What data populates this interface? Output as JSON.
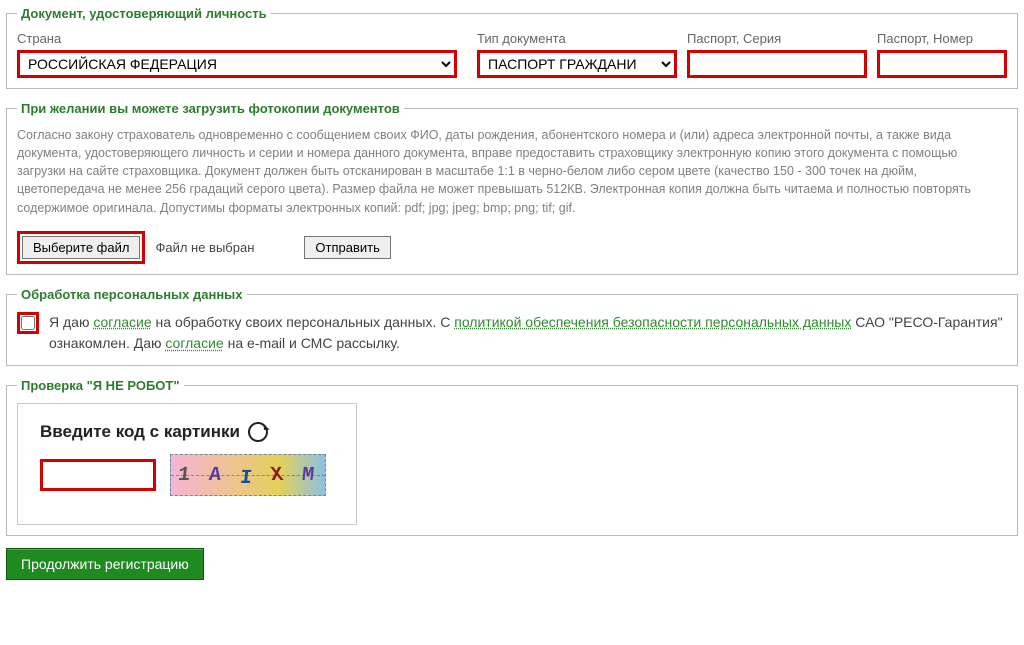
{
  "identity": {
    "legend": "Документ, удостоверяющий личность",
    "country_label": "Страна",
    "country_value": "РОССИЙСКАЯ ФЕДЕРАЦИЯ",
    "doctype_label": "Тип документа",
    "doctype_value": "ПАСПОРТ ГРАЖДАНИ",
    "series_label": "Паспорт, Серия",
    "series_value": "",
    "number_label": "Паспорт, Номер",
    "number_value": ""
  },
  "upload": {
    "legend": "При желании вы можете загрузить фотокопии документов",
    "legal_text": "Согласно закону страхователь одновременно с сообщением своих ФИО, даты рождения, абонентского номера и (или) адреса электронной почты, а также вида документа, удостоверяющего личность и серии и номера данного документа, вправе предоставить страховщику электронную копию этого документа с помощью загрузки на сайте страховщика. Документ должен быть отсканирован в масштабе 1:1 в черно-белом либо сером цвете (качество 150 - 300 точек на дюйм, цветопередача не менее 256 градаций серого цвета). Размер файла не может превышать 512КВ. Электронная копия должна быть читаема и полностью повторять содержимое оригинала. Допустимы форматы электронных копий: pdf; jpg; jpeg; bmp; png; tif; gif.",
    "choose_file": "Выберите файл",
    "no_file": "Файл не выбран",
    "send": "Отправить"
  },
  "consent": {
    "legend": "Обработка персональных данных",
    "pre1": "Я даю ",
    "link1": "согласие",
    "mid1": " на обработку своих персональных данных. С ",
    "link2": "политикой обеспечения безопасности персональных данных",
    "mid2": " САО \"РЕСО-Гарантия\" ознакомлен. Даю ",
    "link3": "согласие",
    "post": " на e-mail и СМС рассылку."
  },
  "captcha": {
    "legend": "Проверка \"Я НЕ РОБОТ\"",
    "title": "Введите код с картинки",
    "chars": [
      "1",
      "A",
      "I",
      "X",
      "M"
    ],
    "input_value": ""
  },
  "submit_label": "Продолжить регистрацию"
}
